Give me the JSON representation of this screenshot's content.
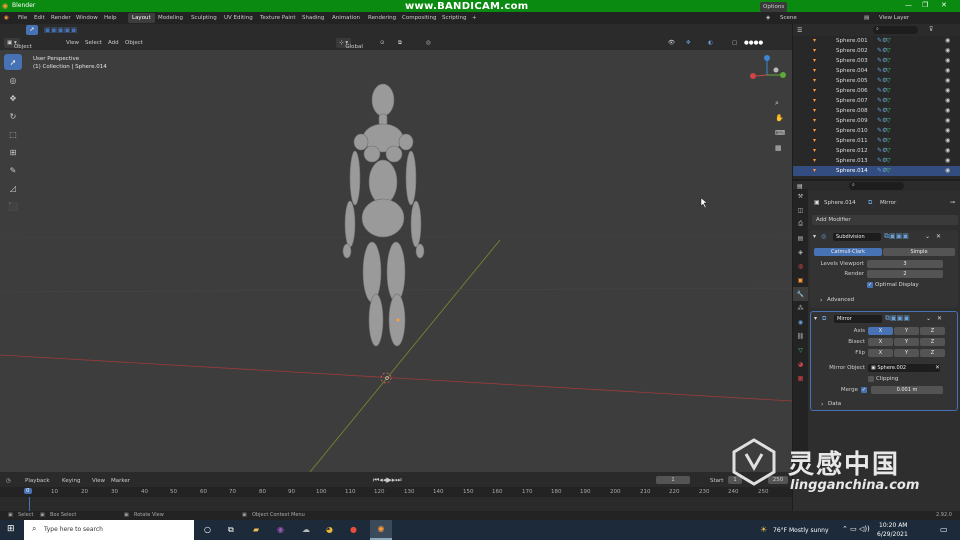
{
  "window": {
    "title": "Blender",
    "watermark": "www.BANDICAM.com"
  },
  "menu": [
    "File",
    "Edit",
    "Render",
    "Window",
    "Help"
  ],
  "workspaces": [
    "Layout",
    "Modeling",
    "Sculpting",
    "UV Editing",
    "Texture Paint",
    "Shading",
    "Animation",
    "Rendering",
    "Compositing",
    "Scripting"
  ],
  "scene": {
    "scene_label": "Scene",
    "view_layer_label": "View Layer"
  },
  "viewport_header": {
    "mode": "Object Mode",
    "menu": [
      "View",
      "Select",
      "Add",
      "Object"
    ],
    "transform_orientation": "Global",
    "options_label": "Options"
  },
  "viewport": {
    "perspective": "User Perspective",
    "collection_info": "(1) Collection | Sphere.014",
    "gizmo_x": "X",
    "gizmo_y": "Y",
    "gizmo_z": "Z"
  },
  "outliner": {
    "items": [
      "Sphere.001",
      "Sphere.002",
      "Sphere.003",
      "Sphere.004",
      "Sphere.005",
      "Sphere.006",
      "Sphere.007",
      "Sphere.008",
      "Sphere.009",
      "Sphere.010",
      "Sphere.011",
      "Sphere.012",
      "Sphere.013",
      "Sphere.014"
    ]
  },
  "properties": {
    "object_name": "Sphere.014",
    "modifier_context": "Mirror",
    "add_modifier": "Add Modifier",
    "subdivision": {
      "name": "Subdivision",
      "type_options": [
        "Catmull-Clark",
        "Simple"
      ],
      "levels_viewport_label": "Levels Viewport",
      "levels_viewport": "3",
      "render_label": "Render",
      "render": "2",
      "optimal_display": "Optimal Display",
      "advanced": "Advanced"
    },
    "mirror": {
      "name": "Mirror",
      "axis_label": "Axis",
      "bisect_label": "Bisect",
      "flip_label": "Flip",
      "x": "X",
      "y": "Y",
      "z": "Z",
      "mirror_object_label": "Mirror Object",
      "mirror_object": "Sphere.002",
      "clipping": "Clipping",
      "merge_label": "Merge",
      "merge_value": "0.001 m",
      "data": "Data"
    }
  },
  "timeline": {
    "menu": [
      "Playback",
      "Keying",
      "View",
      "Marker"
    ],
    "current_frame": "1",
    "start_label": "Start",
    "start_value": "1",
    "end_value": "250",
    "ruler": [
      "0",
      "10",
      "20",
      "30",
      "40",
      "50",
      "60",
      "70",
      "80",
      "90",
      "100",
      "110",
      "120",
      "130",
      "140",
      "150",
      "160",
      "170",
      "180",
      "190",
      "200",
      "210",
      "220",
      "230",
      "240",
      "250"
    ]
  },
  "statusbar": {
    "select": "Select",
    "box_select": "Box Select",
    "rotate_view": "Rotate View",
    "context_menu": "Object Context Menu",
    "version": "2.92.0"
  },
  "taskbar": {
    "search_placeholder": "Type here to search",
    "weather": "76°F  Mostly sunny",
    "time": "10:20 AM",
    "date": "6/29/2021"
  },
  "brand_watermark": {
    "cn": "灵感中国",
    "url": "lingganchina.com"
  }
}
